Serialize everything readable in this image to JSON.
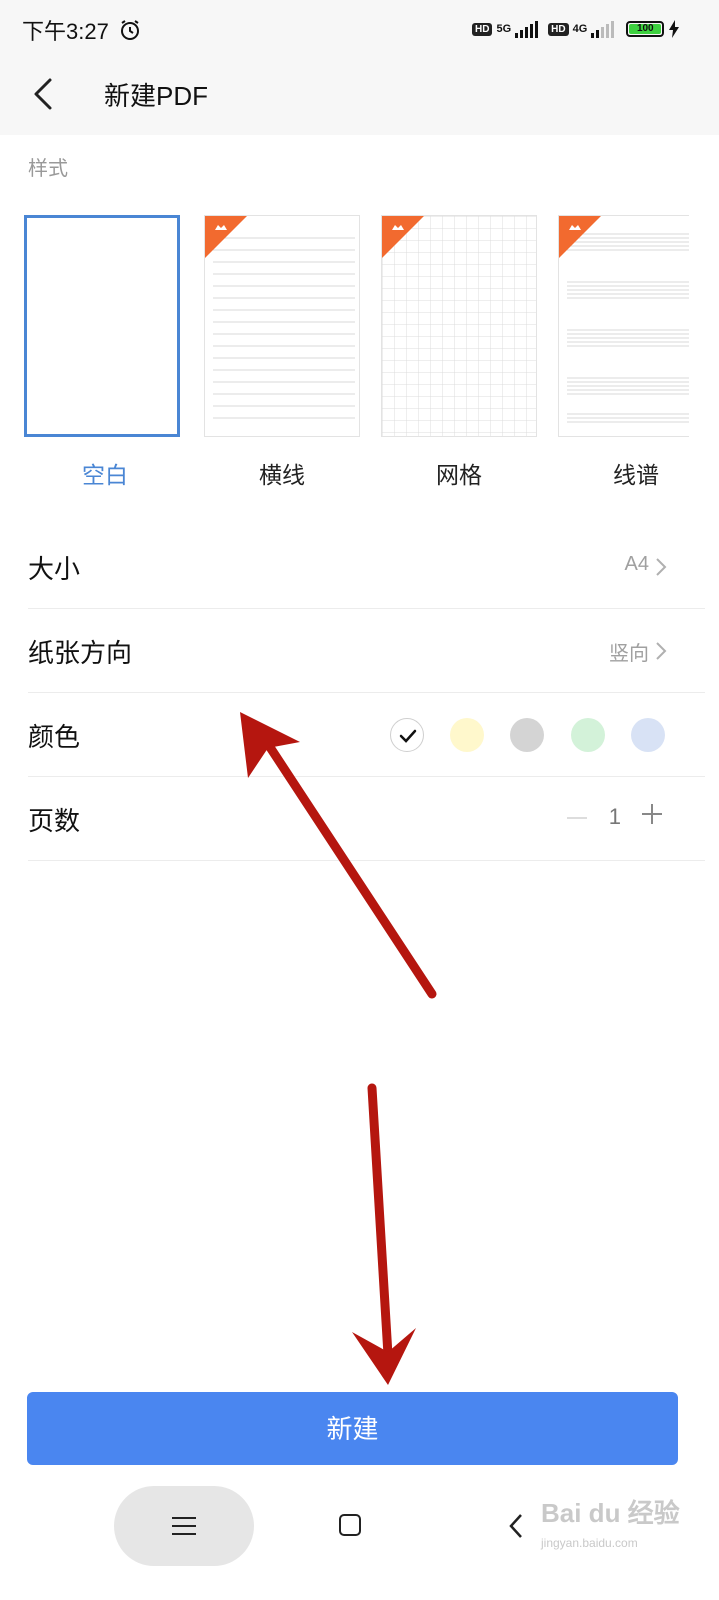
{
  "status_bar": {
    "time": "下午3:27",
    "sim1": {
      "badge": "HD",
      "network": "5G"
    },
    "sim2": {
      "badge": "HD",
      "network": "4G"
    },
    "battery": "100"
  },
  "header": {
    "title": "新建PDF"
  },
  "style_section": {
    "label": "样式",
    "templates": [
      {
        "label": "空白",
        "selected": true,
        "premium": false
      },
      {
        "label": "横线",
        "selected": false,
        "premium": true
      },
      {
        "label": "网格",
        "selected": false,
        "premium": true
      },
      {
        "label": "线谱",
        "selected": false,
        "premium": true
      }
    ]
  },
  "settings": {
    "size": {
      "label": "大小",
      "value": "A4"
    },
    "orientation": {
      "label": "纸张方向",
      "value": "竖向"
    },
    "color": {
      "label": "颜色",
      "options": [
        "#ffffff",
        "#fff8cc",
        "#d4d4d4",
        "#d3f2d9",
        "#d8e2f5"
      ],
      "selected_index": 0
    },
    "pages": {
      "label": "页数",
      "value": "1"
    }
  },
  "create_button": {
    "label": "新建"
  },
  "colors": {
    "accent": "#4a86f0",
    "selected_border": "#4a86d4",
    "premium_ribbon": "#f26a2f"
  },
  "watermark": {
    "text": "Bai du 经验",
    "sub": "jingyan.baidu.com"
  }
}
